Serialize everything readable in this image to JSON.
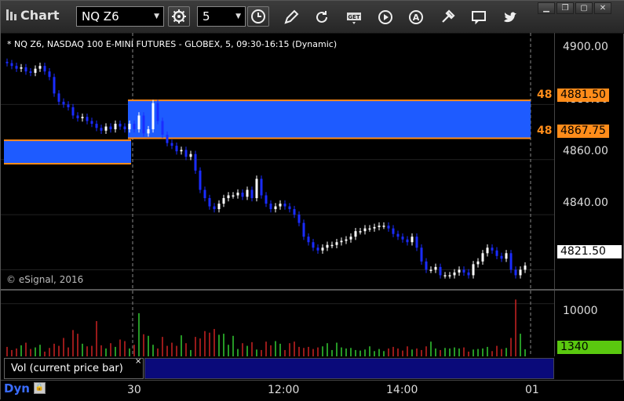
{
  "app": {
    "title": "Chart",
    "logo_icon": "chart-logo-icon"
  },
  "toolbar": {
    "symbol": "NQ Z6",
    "interval": "5",
    "icons": [
      "settings-gear-icon",
      "clock-icon",
      "pencil-icon",
      "refresh-icon",
      "get-icon",
      "play-icon",
      "alert-icon",
      "tools-icon",
      "chat-icon",
      "twitter-icon"
    ],
    "window_buttons": [
      "minimize",
      "maximize",
      "close"
    ]
  },
  "header": {
    "text": "* NQ Z6, NASDAQ 100 E-MINI FUTURES - GLOBEX, 5, 09:30-16:15 (Dynamic)"
  },
  "copyright": "© eSignal, 2016",
  "price_axis": {
    "labels": [
      "4900.00",
      "4880.00",
      "4860.00",
      "4840.00",
      "4820.00"
    ],
    "last_price": "4821.50",
    "level_tags": [
      {
        "prefix": "48",
        "value": "4881.50"
      },
      {
        "prefix": "48",
        "value": "4867.75"
      }
    ]
  },
  "volume_axis": {
    "labels": [
      "10000",
      "0"
    ],
    "last_volume": "1340"
  },
  "study": {
    "label": "Vol (current price bar)",
    "close": "×"
  },
  "time_axis": {
    "labels": [
      "30",
      "12:00",
      "14:00",
      "01"
    ]
  },
  "status": {
    "mode": "Dyn"
  },
  "colors": {
    "up": "#ffffff",
    "down": "#1a2cff",
    "zone": "#1e5bff",
    "level": "#ff8c1a",
    "vol_up": "#33cc33",
    "vol_down": "#cc2222",
    "last_vol": "#5ac80f"
  },
  "chart_data": {
    "type": "candlestick",
    "ylim": [
      4813,
      4906
    ],
    "zones": [
      {
        "top": 4867.0,
        "bottom": 4858.5,
        "session": "prior"
      },
      {
        "top": 4881.5,
        "bottom": 4867.75,
        "session": "current"
      }
    ],
    "closes": [
      4895,
      4894,
      4893,
      4893.5,
      4892,
      4891.5,
      4893,
      4894,
      4892,
      4890,
      4884,
      4881,
      4880,
      4879,
      4876,
      4875,
      4875.5,
      4874,
      4873,
      4871.5,
      4870.5,
      4872,
      4871,
      4873,
      4872,
      4871,
      4873,
      4871,
      4876,
      4869.5,
      4871,
      4880.5,
      4874,
      4869,
      4866,
      4865,
      4863,
      4863.5,
      4861,
      4862,
      4856,
      4849,
      4846,
      4843,
      4842,
      4844,
      4846,
      4847,
      4847,
      4848,
      4846.5,
      4849,
      4846,
      4853,
      4847,
      4844,
      4842,
      4843,
      4844,
      4843,
      4842,
      4840,
      4837,
      4832,
      4830,
      4828,
      4827,
      4828,
      4829,
      4829,
      4830,
      4830.5,
      4831,
      4832,
      4834,
      4834,
      4835,
      4835,
      4835.5,
      4836,
      4836,
      4835,
      4833,
      4832,
      4831,
      4830,
      4832,
      4828,
      4823,
      4820,
      4820,
      4821,
      4818,
      4818,
      4818,
      4819,
      4820,
      4819,
      4818,
      4822,
      4823,
      4826,
      4828,
      4827,
      4825,
      4824,
      4826,
      4820,
      4818,
      4820,
      4821.5
    ],
    "volume": [
      1800,
      1200,
      1500,
      2100,
      2600,
      1400,
      1700,
      2200,
      900,
      1600,
      2400,
      2000,
      3500,
      1700,
      5000,
      4300,
      2400,
      1900,
      2000,
      6700,
      2100,
      1500,
      2500,
      1800,
      3200,
      2900,
      1500,
      2200,
      8200,
      4200,
      3900,
      2200,
      1500,
      3700,
      2000,
      2600,
      2000,
      4000,
      2500,
      1200,
      3700,
      3400,
      4800,
      4500,
      5200,
      4100,
      4300,
      2200,
      3900,
      1400,
      2500,
      2000,
      2700,
      1300,
      1200,
      2800,
      2100,
      2900,
      2400,
      1200,
      2500,
      2800,
      1800,
      1600,
      1800,
      1400,
      1700,
      1900,
      2500,
      1200,
      2600,
      1700,
      1500,
      1600,
      1200,
      1100,
      1300,
      1900,
      1000,
      1400,
      1000,
      1500,
      1800,
      1500,
      1100,
      1900,
      1300,
      1500,
      1200,
      1900,
      2800,
      1500,
      1200,
      1600,
      1500,
      1700,
      1500,
      1700,
      900,
      1300,
      1400,
      1500,
      1800,
      1000,
      2000,
      1400,
      1600,
      3500,
      10800,
      4300,
      1340
    ]
  }
}
